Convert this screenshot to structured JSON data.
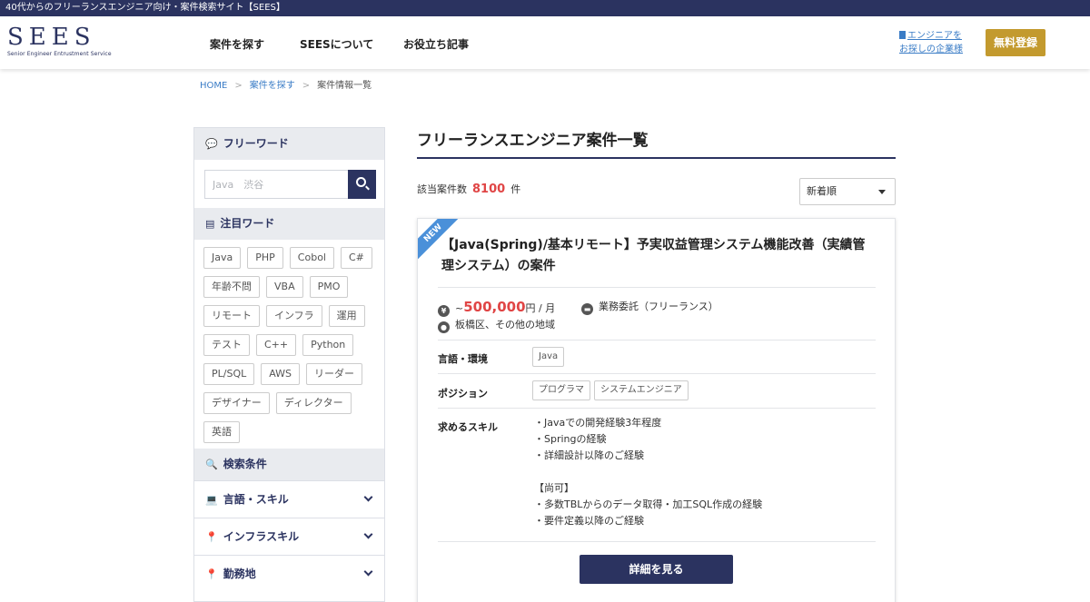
{
  "topbar": {
    "text": "40代からのフリーランスエンジニア向け・案件検索サイト【SEES】"
  },
  "header": {
    "logo": "SEES",
    "logo_sub": "Senior Engineer Entrustment Service",
    "nav": [
      "案件を探す",
      "SEESについて",
      "お役立ち記事"
    ],
    "corp_link_line1": "エンジニアを",
    "corp_link_line2": "お探しの企業様",
    "signup": "無料登録"
  },
  "breadcrumb": [
    "HOME",
    "案件を探す",
    "案件情報一覧"
  ],
  "sidebar": {
    "freeword_title": "フリーワード",
    "search_placeholder": "Java　渋谷",
    "hot_title": "注目ワード",
    "tags": [
      "Java",
      "PHP",
      "Cobol",
      "C#",
      "年齢不問",
      "VBA",
      "PMO",
      "リモート",
      "インフラ",
      "運用",
      "テスト",
      "C++",
      "Python",
      "PL/SQL",
      "AWS",
      "リーダー",
      "デザイナー",
      "ディレクター",
      "英語"
    ],
    "conditions_title": "検索条件",
    "accordions": [
      "言語・スキル",
      "インフラスキル",
      "勤務地"
    ]
  },
  "main": {
    "title": "フリーランスエンジニア案件一覧",
    "count_label": "該当案件数",
    "count": "8100",
    "count_unit": "件",
    "sort": "新着順"
  },
  "card": {
    "badge": "NEW",
    "title": "【Java(Spring)/基本リモート】予実収益管理システム機能改善（実績管理システム）の案件",
    "price_prefix": "~",
    "price": "500,000",
    "price_unit": "円 / 月",
    "contract": "業務委託（フリーランス）",
    "location": "板橋区、その他の地域",
    "lang_label": "言語・環境",
    "langs": [
      "Java"
    ],
    "position_label": "ポジション",
    "positions": [
      "プログラマ",
      "システムエンジニア"
    ],
    "skills_label": "求めるスキル",
    "skills": [
      "・Javaでの開発経験3年程度",
      "・Springの経験",
      "・詳細設計以降のご経験",
      "",
      "【尚可】",
      "・多数TBLからのデータ取得・加工SQL作成の経験",
      "・要件定義以降のご経験"
    ],
    "detail_button": "詳細を見る"
  },
  "colors": {
    "navy": "#2b3360",
    "gold": "#c39a2e",
    "accent_red": "#e04545",
    "link_blue": "#3a7cc6"
  }
}
